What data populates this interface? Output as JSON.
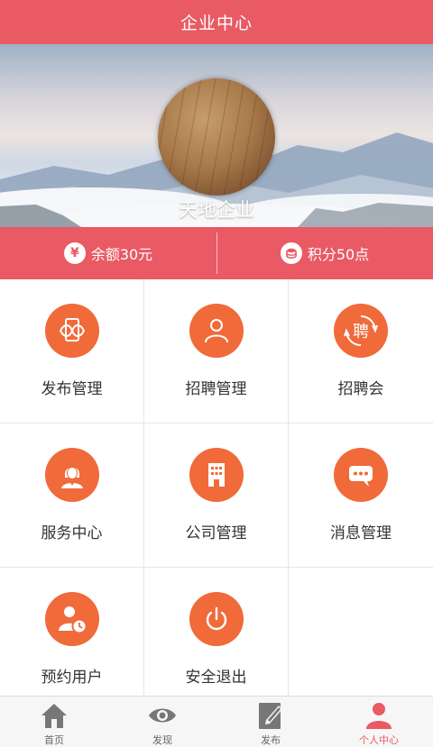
{
  "header": {
    "title": "企业中心"
  },
  "profile": {
    "company_name": "天地企业"
  },
  "stats": {
    "balance": {
      "icon": "yen-icon",
      "label": "余额30元"
    },
    "points": {
      "icon": "coin-icon",
      "label": "积分50点"
    }
  },
  "menu": {
    "items": [
      {
        "label": "发布管理",
        "icon": "publish-icon"
      },
      {
        "label": "招聘管理",
        "icon": "user-icon"
      },
      {
        "label": "招聘会",
        "icon": "recruit-fair-icon",
        "glyph": "聘"
      },
      {
        "label": "服务中心",
        "icon": "service-agent-icon"
      },
      {
        "label": "公司管理",
        "icon": "building-icon"
      },
      {
        "label": "消息管理",
        "icon": "message-icon"
      },
      {
        "label": "预约用户",
        "icon": "user-clock-icon"
      },
      {
        "label": "安全退出",
        "icon": "power-icon"
      }
    ]
  },
  "tabbar": {
    "tabs": [
      {
        "label": "首页",
        "icon": "home-icon"
      },
      {
        "label": "发现",
        "icon": "eye-icon"
      },
      {
        "label": "发布",
        "icon": "edit-icon"
      },
      {
        "label": "个人中心",
        "icon": "person-icon",
        "active": true
      }
    ]
  },
  "colors": {
    "brand": "#e95a64",
    "accent": "#f06a3a"
  }
}
